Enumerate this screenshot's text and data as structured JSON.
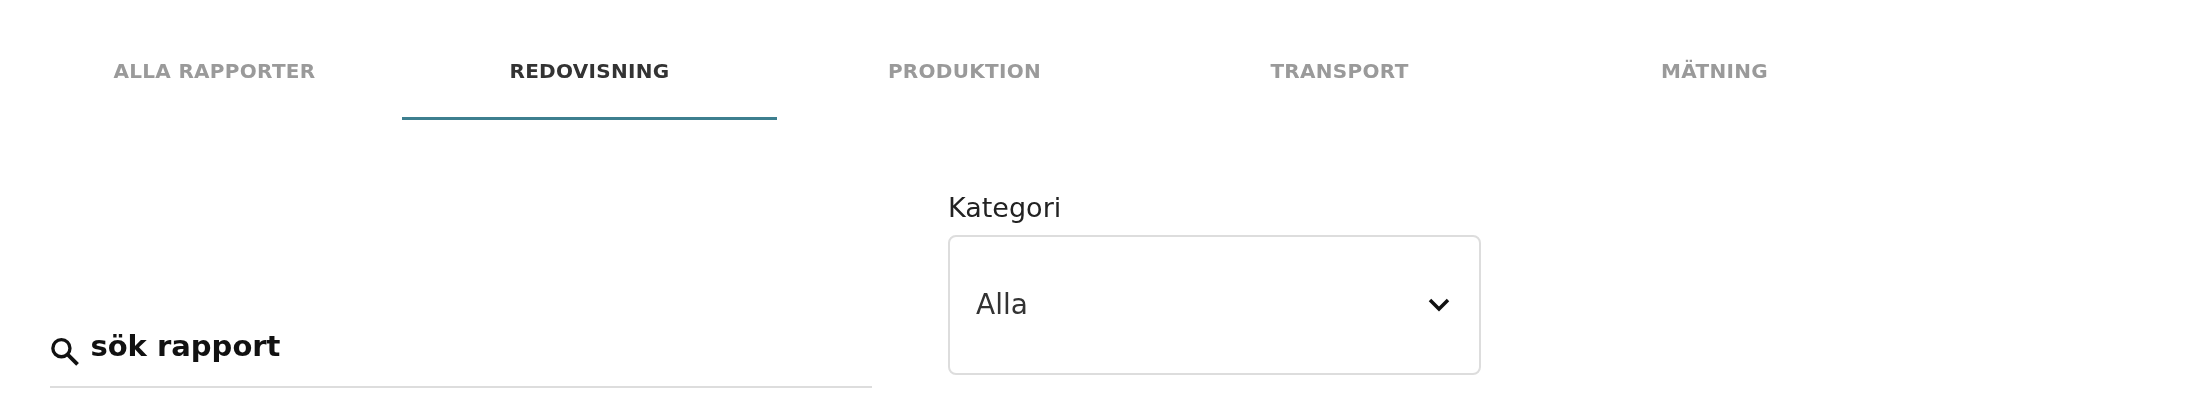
{
  "tabs": [
    {
      "label": "ALLA RAPPORTER",
      "selected": false
    },
    {
      "label": "REDOVISNING",
      "selected": true
    },
    {
      "label": "PRODUKTION",
      "selected": false
    },
    {
      "label": "TRANSPORT",
      "selected": false
    },
    {
      "label": "MÄTNING",
      "selected": false
    }
  ],
  "search": {
    "placeholder": "sök rapport"
  },
  "category": {
    "label": "Kategori",
    "value": "Alla"
  }
}
